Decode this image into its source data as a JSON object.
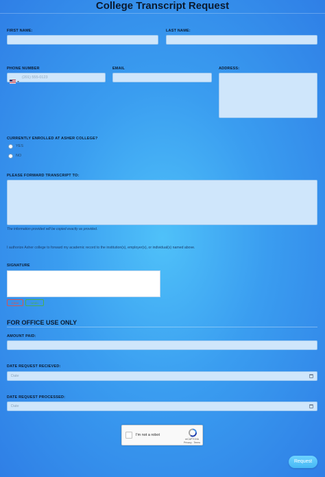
{
  "title": "College Transcript Request",
  "fields": {
    "first_name_label": "FIRST NAME:",
    "last_name_label": "LAST NAME:",
    "phone_label": "PHONE NUMBER",
    "phone_placeholder": "(201) 555-0123",
    "email_label": "EMAIL",
    "address_label": "ADDRESS:",
    "enrolled_label": "CURRENTLY ENROLLED AT ASHER COLLEGE?",
    "enrolled_options": [
      "YES",
      "NO"
    ],
    "forward_label": "PLEASE FORWARD TRANSCRIPT TO:",
    "forward_note": "The information provided will be copied exactly as provided.",
    "consent_text": "I authorize Asher college to forward my academic record to the institution(s), employer(s), or individual(s) named above.",
    "signature_label": "SIGNATURE",
    "signature_clear": "Clear",
    "signature_undo": "Undo"
  },
  "office": {
    "heading": "FOR OFFICE USE ONLY",
    "amount_label": "AMOUNT PAID:",
    "received_label": "DATE REQUEST RECIEVED:",
    "received_placeholder": "Date",
    "processed_label": "DATE REQUEST PROCESSED:",
    "processed_placeholder": "Date"
  },
  "captcha": {
    "label": "I'm not a robot",
    "brand": "reCAPTCHA",
    "links": "Privacy - Terms"
  },
  "submit_label": "Request",
  "colors": {
    "background": "#3a9df0",
    "field": "#cfe6fb",
    "submit": "#46b8f5"
  }
}
